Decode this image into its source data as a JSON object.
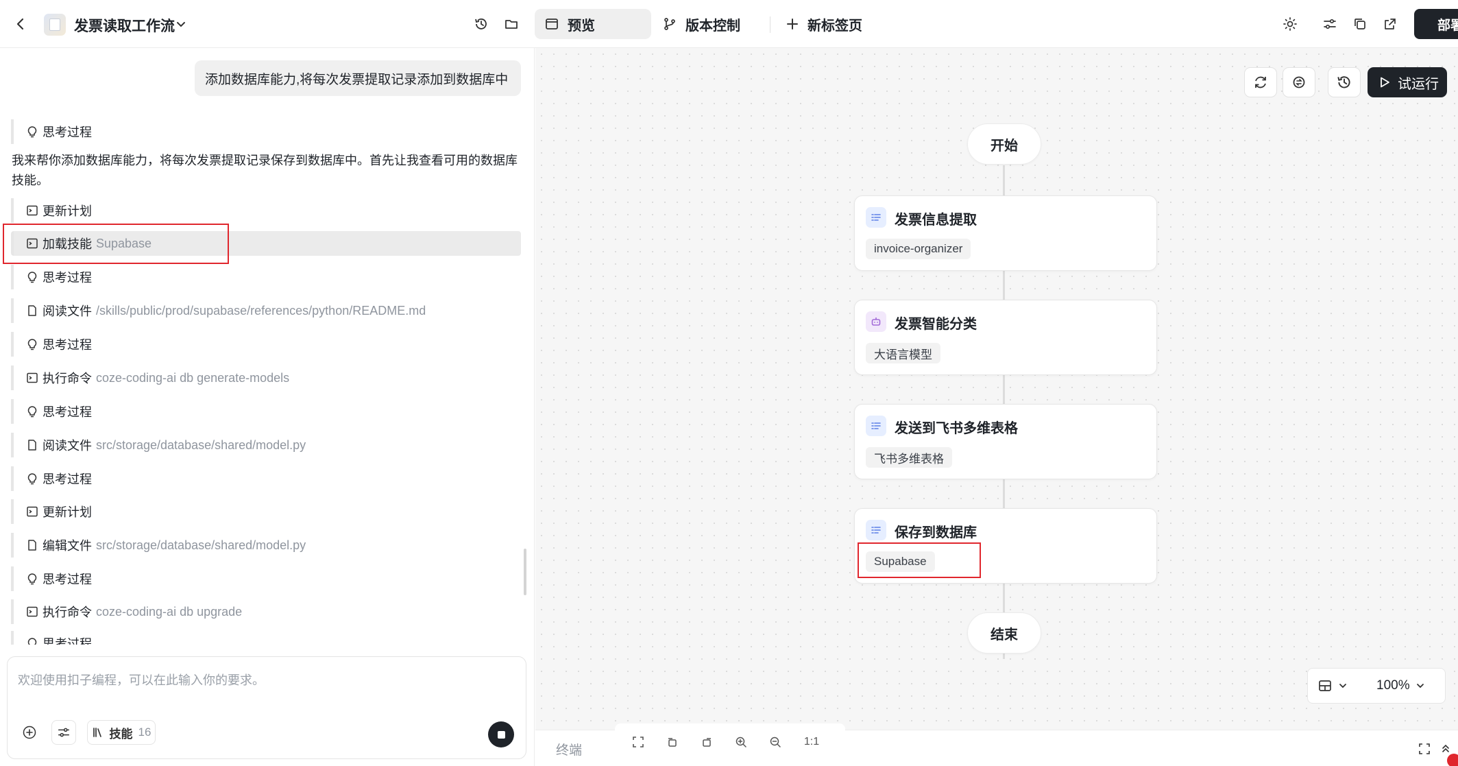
{
  "header": {
    "title": "发票读取工作流",
    "tabs": [
      {
        "label": "预览",
        "icon": "browser-icon",
        "active": true
      },
      {
        "label": "版本控制",
        "icon": "branch-icon",
        "active": false
      },
      {
        "label": "新标签页",
        "icon": "plus-icon",
        "active": false
      }
    ],
    "deploy_label": "部署"
  },
  "chat": {
    "user_message": "添加数据库能力,将每次发票提取记录添加到数据库中",
    "assistant_text": "我来帮你添加数据库能力，将每次发票提取记录保存到数据库中。首先让我查看可用的数据库技能。",
    "steps": [
      {
        "label": "思考过程",
        "detail": "",
        "icon": "bulb-icon"
      },
      {
        "label": "更新计划",
        "detail": "",
        "icon": "terminal-icon"
      },
      {
        "label": "加载技能",
        "detail": "Supabase",
        "icon": "terminal-icon"
      },
      {
        "label": "思考过程",
        "detail": "",
        "icon": "bulb-icon"
      },
      {
        "label": "阅读文件",
        "detail": "/skills/public/prod/supabase/references/python/README.md",
        "icon": "file-icon"
      },
      {
        "label": "思考过程",
        "detail": "",
        "icon": "bulb-icon"
      },
      {
        "label": "执行命令",
        "detail": "coze-coding-ai db generate-models",
        "icon": "terminal-icon"
      },
      {
        "label": "思考过程",
        "detail": "",
        "icon": "bulb-icon"
      },
      {
        "label": "阅读文件",
        "detail": "src/storage/database/shared/model.py",
        "icon": "file-icon"
      },
      {
        "label": "思考过程",
        "detail": "",
        "icon": "bulb-icon"
      },
      {
        "label": "更新计划",
        "detail": "",
        "icon": "terminal-icon"
      },
      {
        "label": "编辑文件",
        "detail": "src/storage/database/shared/model.py",
        "icon": "file-icon"
      },
      {
        "label": "思考过程",
        "detail": "",
        "icon": "bulb-icon"
      },
      {
        "label": "执行命令",
        "detail": "coze-coding-ai db upgrade",
        "icon": "terminal-icon"
      },
      {
        "label": "思考过程",
        "detail": "",
        "icon": "bulb-icon"
      }
    ],
    "input_placeholder": "欢迎使用扣子编程，可以在此输入你的要求。",
    "skills_label": "技能",
    "skills_count": "16"
  },
  "canvas": {
    "run_label": "试运行",
    "start_label": "开始",
    "end_label": "结束",
    "nodes": [
      {
        "title": "发票信息提取",
        "tag": "invoice-organizer",
        "icon": "list-icon"
      },
      {
        "title": "发票智能分类",
        "tag": "大语言模型",
        "icon": "robot-icon"
      },
      {
        "title": "发送到飞书多维表格",
        "tag": "飞书多维表格",
        "icon": "list-icon"
      },
      {
        "title": "保存到数据库",
        "tag": "Supabase",
        "icon": "list-icon"
      }
    ],
    "zoom": "100%"
  },
  "bottom": {
    "terminal_label": "终端",
    "ratio_label": "1:1"
  },
  "colors": {
    "highlight_box": "#e0262d",
    "primary_dark": "#1f2329",
    "canvas_bg": "#f6f6f6"
  }
}
